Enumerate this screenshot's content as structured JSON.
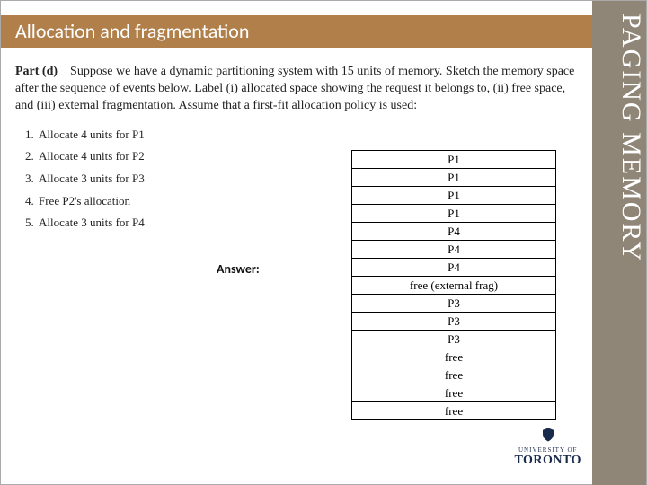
{
  "title": "Allocation and fragmentation",
  "side_tab": "PAGING MEMORY",
  "part": {
    "label": "Part (d)",
    "text": "Suppose we have a dynamic partitioning system with 15 units of memory. Sketch the memory space after the sequence of events below. Label (i) allocated space showing the request it belongs to, (ii) free space, and (iii) external fragmentation. Assume that a first-fit allocation policy is used:"
  },
  "steps": [
    "Allocate 4 units for P1",
    "Allocate 4 units for P2",
    "Allocate 3 units for P3",
    "Free P2's allocation",
    "Allocate 3 units for P4"
  ],
  "answer_label": "Answer:",
  "memory_cells": [
    "P1",
    "P1",
    "P1",
    "P1",
    "P4",
    "P4",
    "P4",
    "free (external frag)",
    "P3",
    "P3",
    "P3",
    "free",
    "free",
    "free",
    "free"
  ],
  "logo": {
    "uni_small": "UNIVERSITY OF",
    "city": "TORONTO"
  }
}
